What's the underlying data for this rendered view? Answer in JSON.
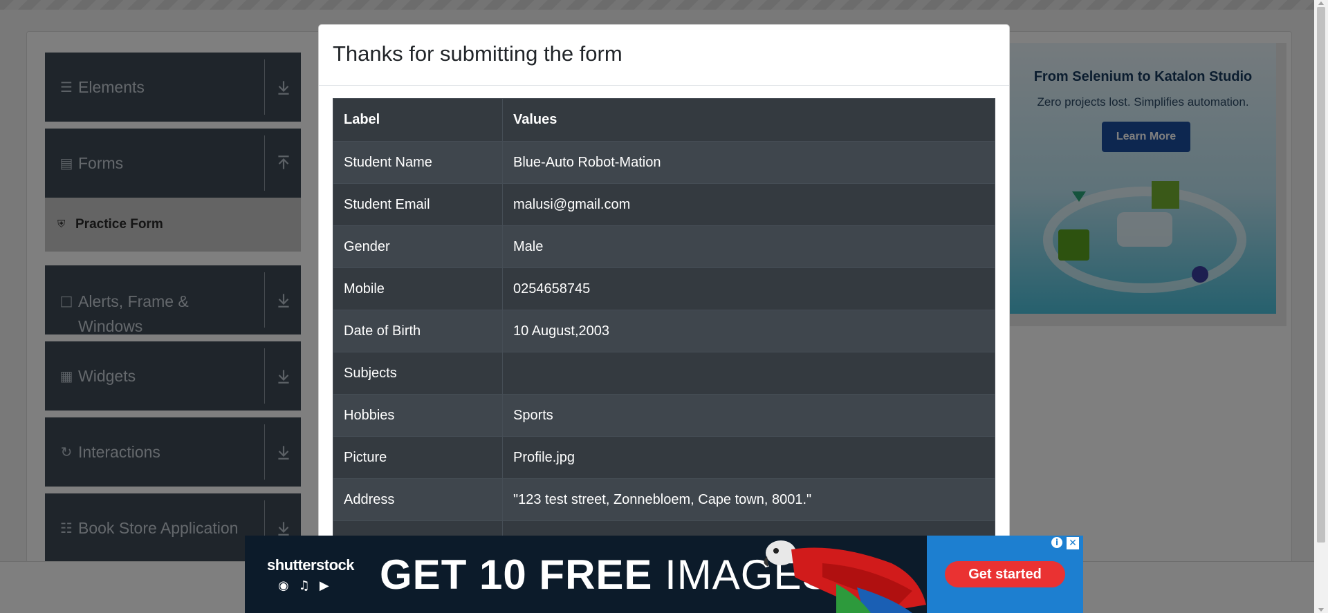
{
  "sidebar": {
    "groups": [
      {
        "label": "Elements",
        "icon": "menu-lines-icon"
      },
      {
        "label": "Forms",
        "icon": "document-icon"
      },
      {
        "label": "Alerts, Frame & Windows",
        "icon": "window-icon"
      },
      {
        "label": "Widgets",
        "icon": "widgets-icon"
      },
      {
        "label": "Interactions",
        "icon": "refresh-icon"
      },
      {
        "label": "Book Store Application",
        "icon": "books-icon"
      }
    ],
    "active_item": {
      "label": "Practice Form",
      "icon": "html5-icon"
    }
  },
  "ad_right": {
    "title": "From Selenium to Katalon Studio",
    "subtitle": "Zero projects lost. Simplifies automation.",
    "button": "Learn More"
  },
  "modal": {
    "title": "Thanks for submitting the form",
    "columns": [
      "Label",
      "Values"
    ],
    "rows": [
      {
        "label": "Student Name",
        "value": "Blue-Auto Robot-Mation"
      },
      {
        "label": "Student Email",
        "value": "malusi@gmail.com"
      },
      {
        "label": "Gender",
        "value": "Male"
      },
      {
        "label": "Mobile",
        "value": "0254658745"
      },
      {
        "label": "Date of Birth",
        "value": "10 August,2003"
      },
      {
        "label": "Subjects",
        "value": ""
      },
      {
        "label": "Hobbies",
        "value": "Sports"
      },
      {
        "label": "Picture",
        "value": "Profile.jpg"
      },
      {
        "label": "Address",
        "value": "\"123 test street, Zonnebloem, Cape town, 8001.\""
      }
    ]
  },
  "ad_bottom": {
    "brand": "shutterstock",
    "headline_bold": "GET 10 FREE",
    "headline_rest": " IMAGES",
    "cta": "Get started"
  },
  "colors": {
    "sidebar_bg": "#3e4a56",
    "table_dark": "#343a40",
    "table_stripe": "#3f464d",
    "cta_red": "#ea3232",
    "cta_blue": "#1d7fd0"
  }
}
